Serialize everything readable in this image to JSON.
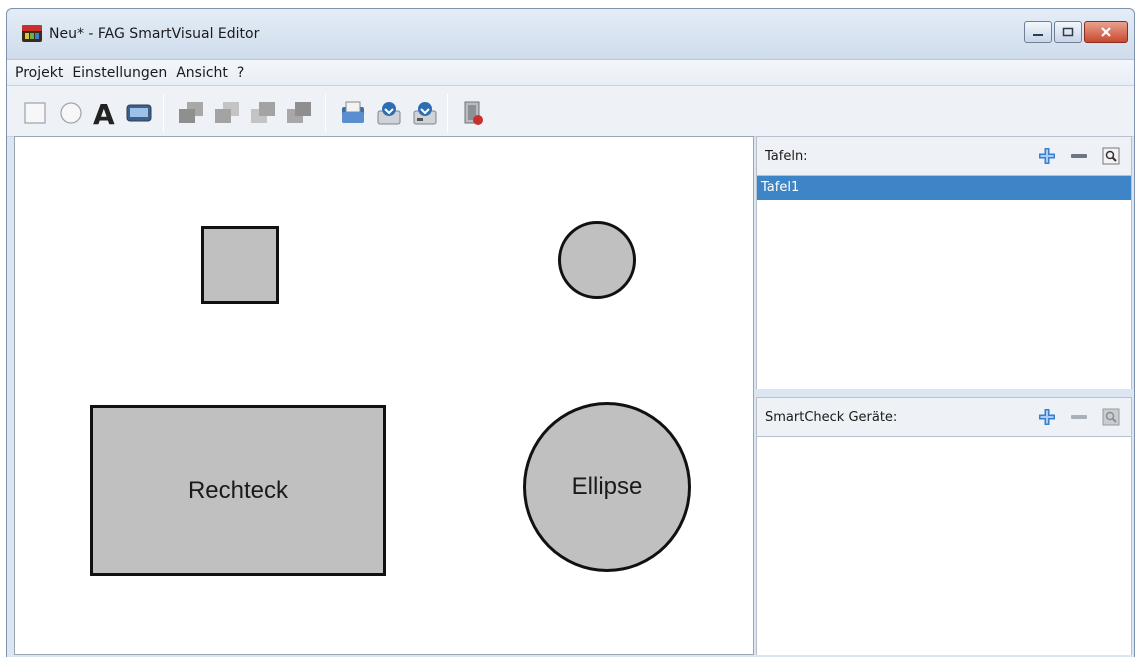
{
  "window": {
    "title": "Neu* - FAG SmartVisual Editor",
    "buttons": {
      "minimize": "–",
      "maximize": "□",
      "close": "✕"
    }
  },
  "menu": {
    "items": [
      "Projekt",
      "Einstellungen",
      "Ansicht",
      "?"
    ]
  },
  "toolbar": {
    "icons": [
      "rectangle-tool-icon",
      "ellipse-tool-icon",
      "text-tool-icon",
      "image-tool-icon",
      "bring-to-front-icon",
      "bring-forward-icon",
      "send-backward-icon",
      "send-to-back-icon",
      "open-project-icon",
      "save-icon",
      "save-as-icon",
      "exit-icon"
    ]
  },
  "canvas": {
    "shapes": [
      {
        "kind": "rectangle",
        "label": ""
      },
      {
        "kind": "ellipse",
        "label": ""
      },
      {
        "kind": "rectangle",
        "label": "Rechteck"
      },
      {
        "kind": "ellipse",
        "label": "Ellipse"
      }
    ],
    "shape_fill": "#c0c0c0",
    "shape_stroke": "#111111"
  },
  "tafeln": {
    "header": "Tafeln:",
    "items": [
      {
        "label": "Tafel1",
        "selected": true
      }
    ],
    "actions": [
      "add-icon",
      "remove-icon",
      "search-icon"
    ]
  },
  "smartcheck": {
    "header": "SmartCheck Geräte:",
    "items": [],
    "actions": [
      "add-icon",
      "remove-icon",
      "search-icon"
    ]
  },
  "colors": {
    "selection": "#3d85c6",
    "accent_add": "#3b7fd0"
  }
}
